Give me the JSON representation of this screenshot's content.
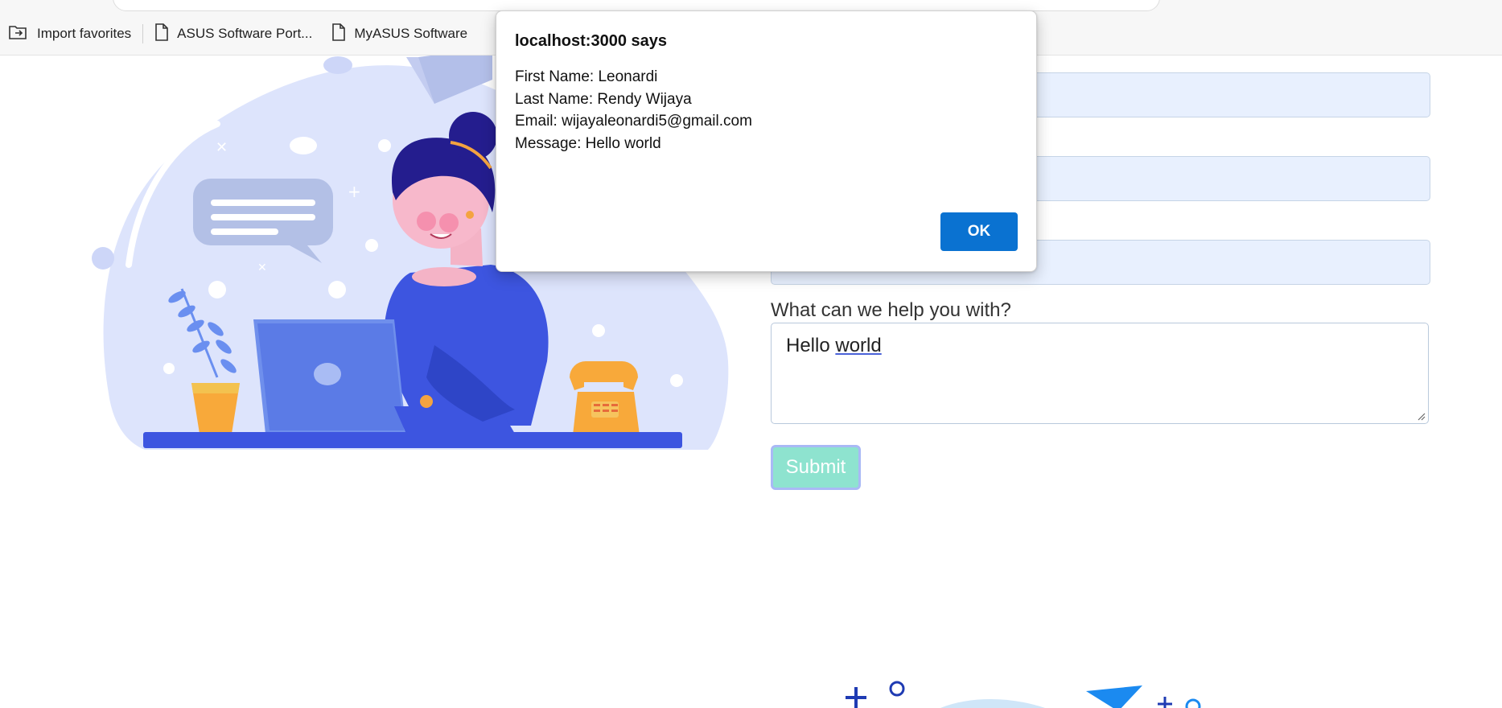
{
  "bookmarks": [
    {
      "label": "Import favorites",
      "icon": "import-favorites-icon"
    },
    {
      "label": "ASUS Software Port...",
      "icon": "page-icon"
    },
    {
      "label": "MyASUS Software",
      "icon": "page-icon"
    }
  ],
  "form": {
    "help_label": "What can we help you with?",
    "message_words": [
      "Hello",
      "world"
    ],
    "submit_label": "Submit"
  },
  "dialog": {
    "title": "localhost:3000 says",
    "lines": [
      "First Name: Leonardi",
      "Last Name: Rendy Wijaya",
      "Email: wijayaleonardi5@gmail.com",
      "Message: Hello world"
    ],
    "ok_label": "OK"
  },
  "colors": {
    "accent": "#0a72d1",
    "input_fill": "#e8f0fe",
    "submit_fill": "#8ee3cf",
    "illustration_blue": "#3d55e0"
  }
}
